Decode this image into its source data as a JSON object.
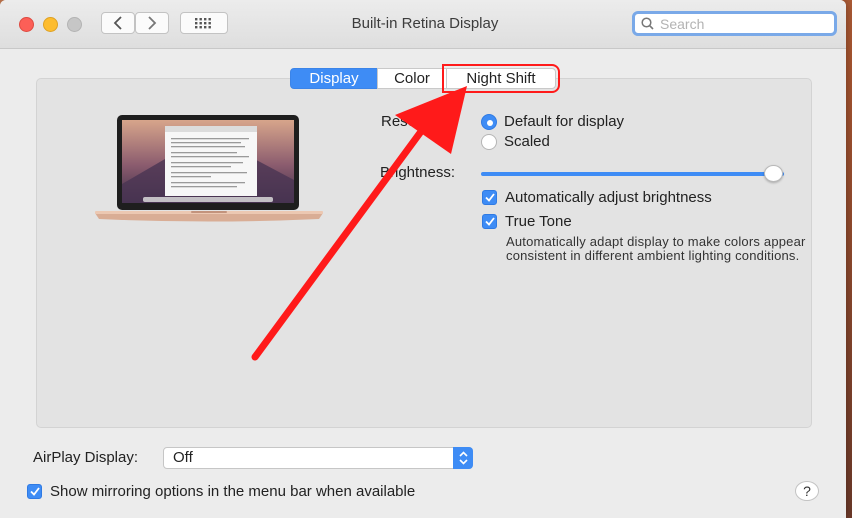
{
  "window": {
    "title": "Built-in Retina Display",
    "search_placeholder": "Search"
  },
  "tabs": [
    {
      "label": "Display",
      "active": true
    },
    {
      "label": "Color",
      "active": false
    },
    {
      "label": "Night Shift",
      "active": false,
      "highlighted": true
    }
  ],
  "display": {
    "resolution_label": "Resolution:",
    "resolution_options": [
      {
        "label": "Default for display",
        "selected": true
      },
      {
        "label": "Scaled",
        "selected": false
      }
    ],
    "brightness_label": "Brightness:",
    "brightness_value": 1.0,
    "auto_brightness_label": "Automatically adjust brightness",
    "auto_brightness_checked": true,
    "true_tone_label": "True Tone",
    "true_tone_checked": true,
    "true_tone_description": "Automatically adapt display to make colors appear consistent in different ambient lighting conditions."
  },
  "airplay": {
    "label": "AirPlay Display:",
    "value": "Off"
  },
  "mirroring": {
    "label": "Show mirroring options in the menu bar when available",
    "checked": true
  },
  "help_label": "?",
  "colors": {
    "accent": "#3e8cf5",
    "annotation": "#ff1a1a"
  }
}
